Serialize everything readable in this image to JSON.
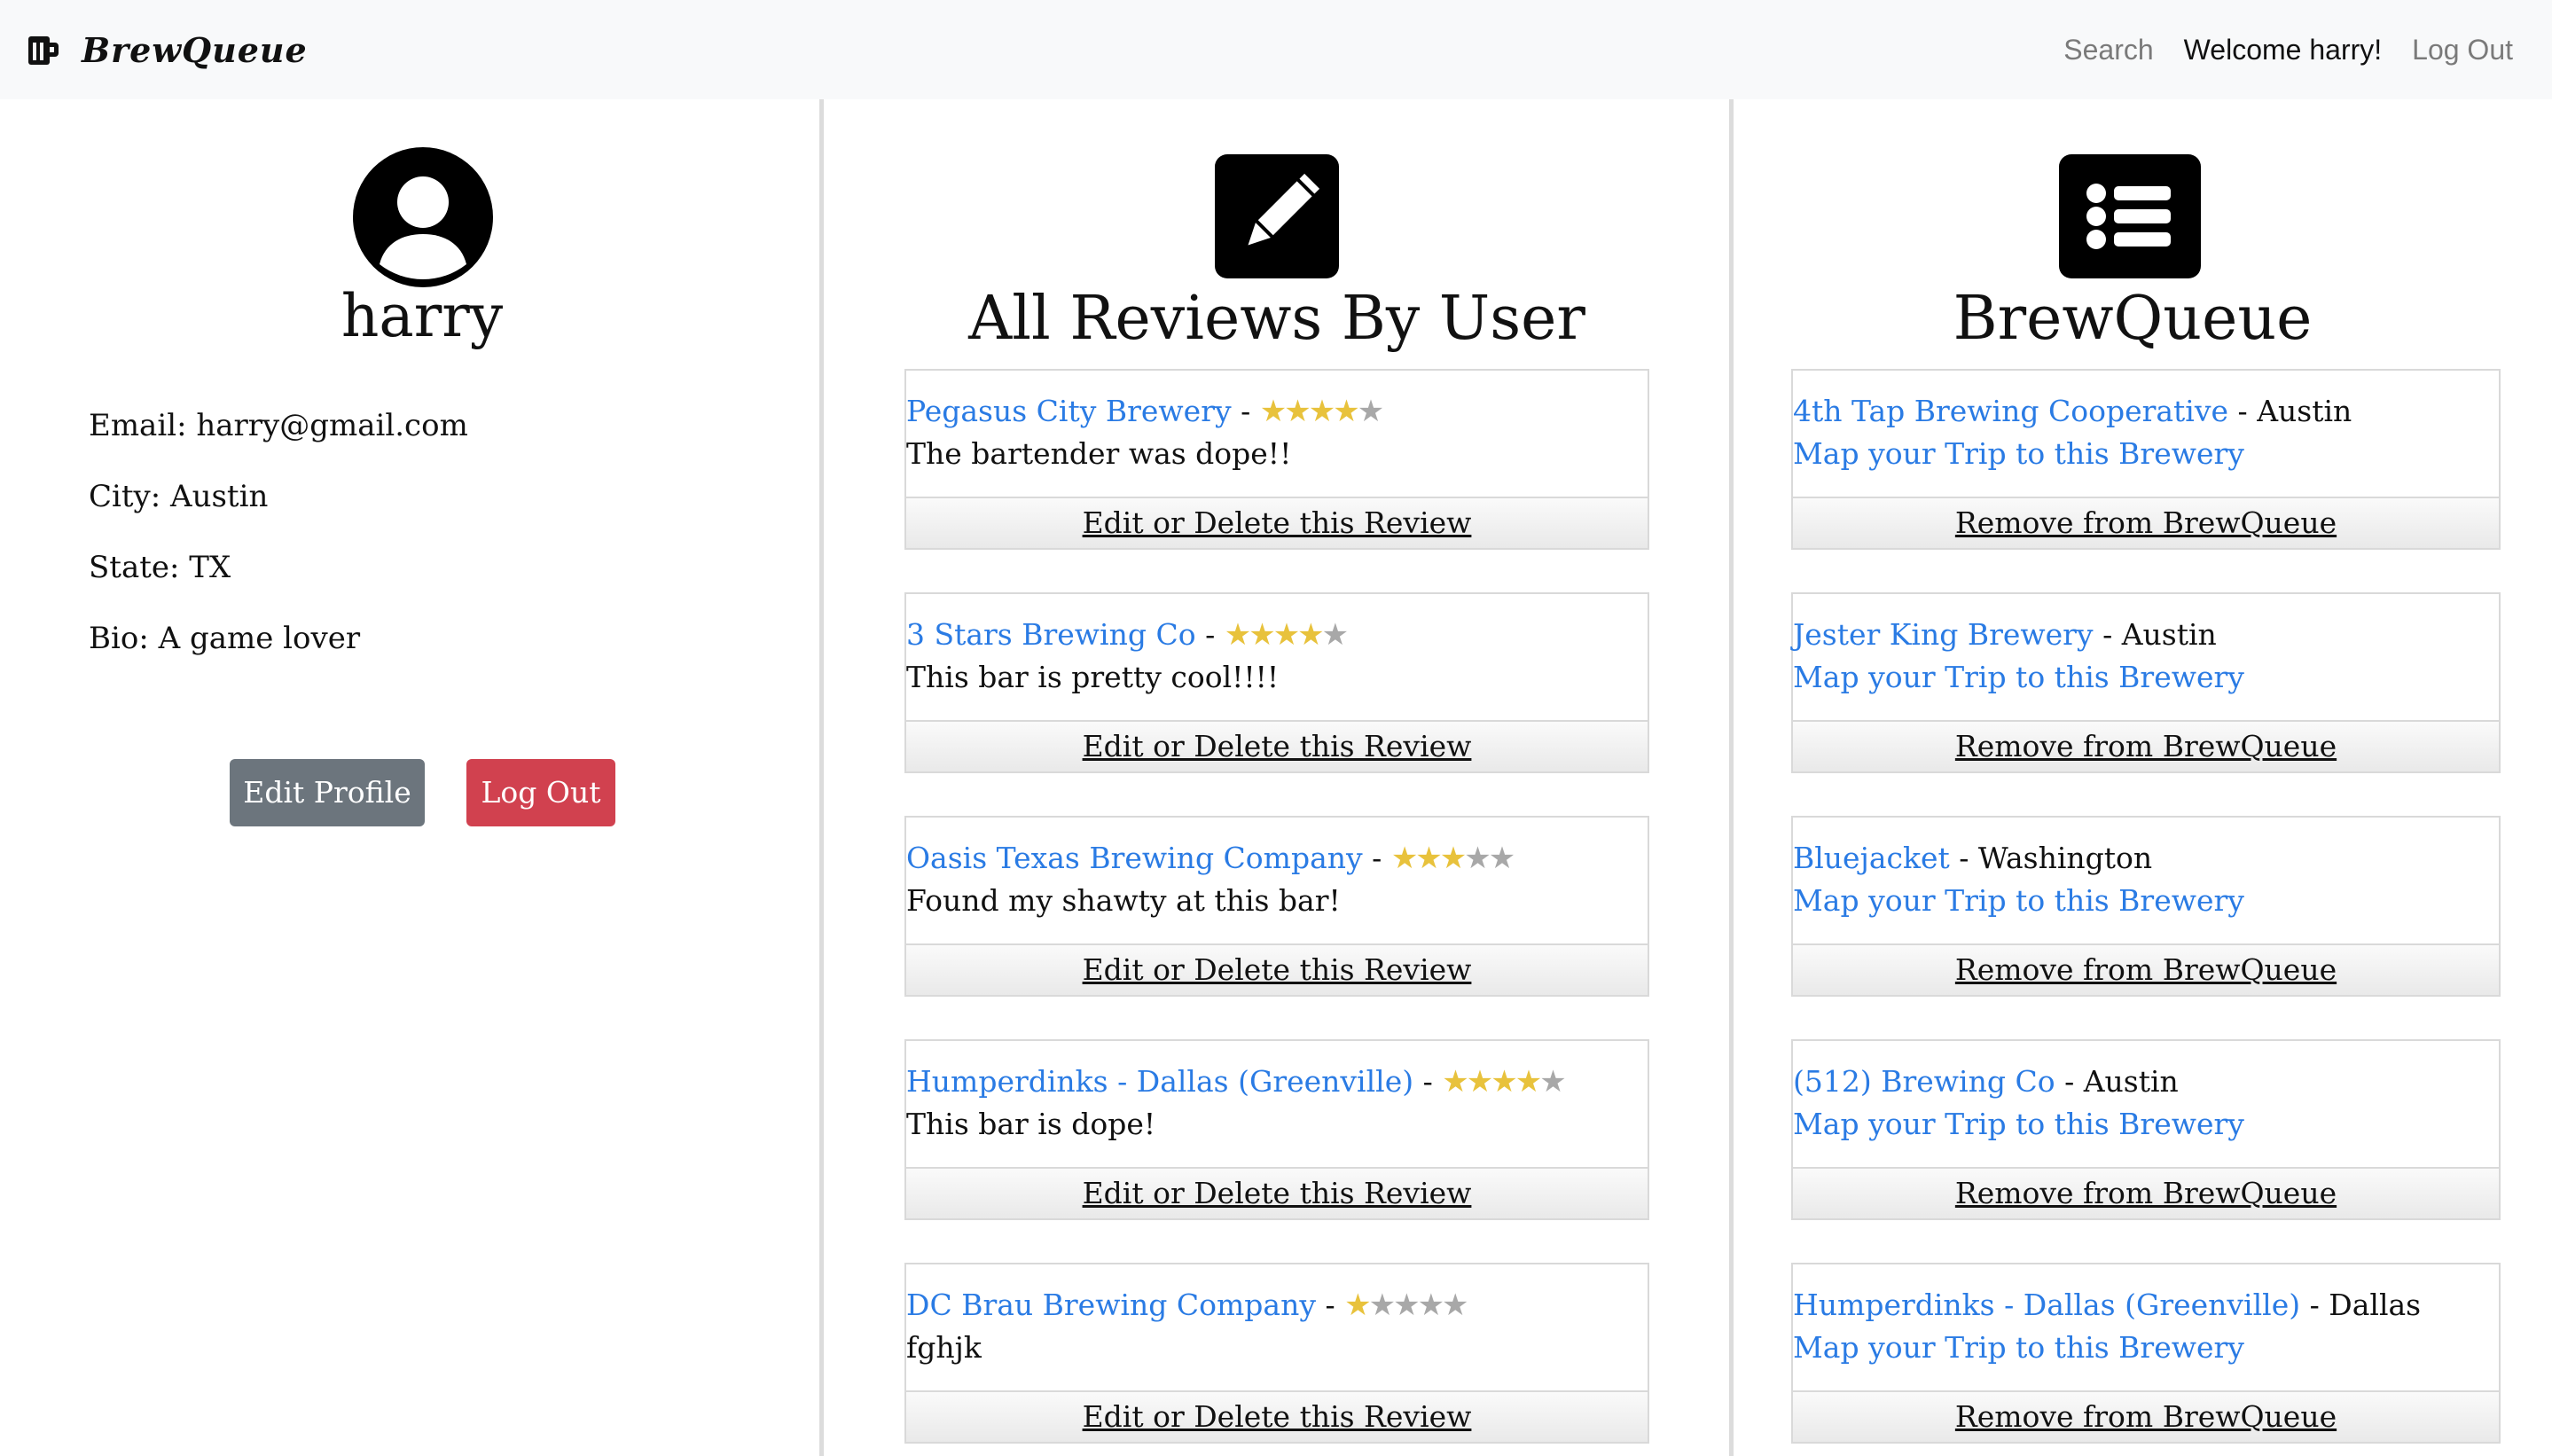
{
  "nav": {
    "brand": "BrewQueue",
    "search": "Search",
    "welcome": "Welcome harry!",
    "logout": "Log Out"
  },
  "profile": {
    "username": "harry",
    "email": "Email: harry@gmail.com",
    "city": "City: Austin",
    "state": "State: TX",
    "bio": "Bio: A game lover",
    "edit_button": "Edit Profile",
    "logout_button": "Log Out"
  },
  "reviews": {
    "title": "All Reviews By User",
    "action_label": "Edit or Delete this Review",
    "items": [
      {
        "brewery": "Pegasus City Brewery",
        "rating": 4,
        "text": "The bartender was dope!!"
      },
      {
        "brewery": "3 Stars Brewing Co",
        "rating": 4,
        "text": "This bar is pretty cool!!!!"
      },
      {
        "brewery": "Oasis Texas Brewing Company",
        "rating": 3,
        "text": "Found my shawty at this bar!"
      },
      {
        "brewery": "Humperdinks - Dallas (Greenville)",
        "rating": 4,
        "text": "This bar is dope!"
      },
      {
        "brewery": "DC Brau Brewing Company",
        "rating": 1,
        "text": "fghjk"
      }
    ]
  },
  "queue": {
    "title": "BrewQueue",
    "map_label": "Map your Trip to this Brewery",
    "remove_label": "Remove from BrewQueue",
    "items": [
      {
        "brewery": "4th Tap Brewing Cooperative",
        "city": "Austin"
      },
      {
        "brewery": "Jester King Brewery",
        "city": "Austin"
      },
      {
        "brewery": "Bluejacket",
        "city": "Washington"
      },
      {
        "brewery": "(512) Brewing Co",
        "city": "Austin"
      },
      {
        "brewery": "Humperdinks - Dallas (Greenville)",
        "city": "Dallas"
      }
    ]
  },
  "separator": " - ",
  "colors": {
    "link": "#2a7be4",
    "star_on": "#e8c23c",
    "star_off": "#a8a8a8",
    "edit_button": "#6c757d",
    "logout_button": "#d1414f",
    "navbar_bg": "#f8f9fa"
  },
  "icons": {
    "brand": "beer-mug-icon",
    "profile": "user-circle-icon",
    "reviews": "edit-icon",
    "queue": "list-icon"
  }
}
